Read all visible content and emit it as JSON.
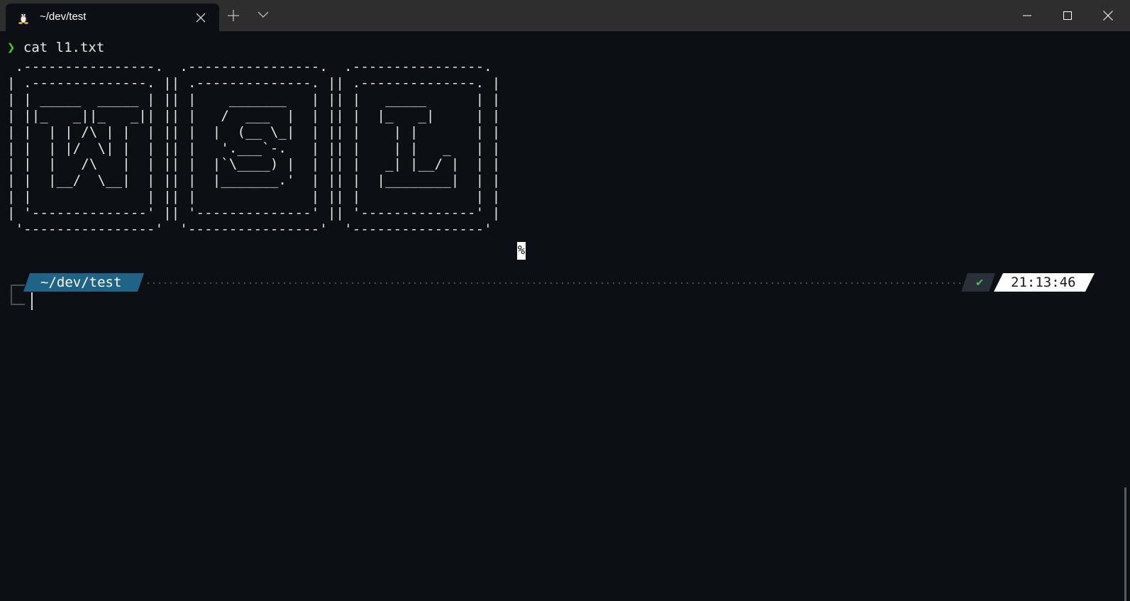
{
  "window": {
    "tab_title": "~/dev/test",
    "tab_icon": "linux-tux-icon"
  },
  "terminal": {
    "prompt_symbol": "❯",
    "command": "cat l1.txt",
    "ascii_art": " .----------------.  .----------------.  .----------------.\n| .--------------. || .--------------. || .--------------. |\n| | _____  _____ | || |    _______   | || |   _____      | |\n| ||_   _||_   _|| || |   /  ___  |  | || |  |_   _|     | |\n| |  | | /\\ | |  | || |  |  (__ \\_|  | || |    | |       | |\n| |  | |/  \\| |  | || |   '.___`-.   | || |    | |   _   | |\n| |  |   /\\   |  | || |  |`\\____) |  | || |   _| |__/ |  | |\n| |  |__/  \\__|  | || |  |_______.'  | || |  |________|  | |\n| |              | || |              | || |              | |\n| '--------------' || '--------------' || '--------------' |\n '----------------'  '----------------'  '----------------'",
    "no_newline_marker": "%"
  },
  "prompt": {
    "path": "~/dev/test",
    "status_icon": "✔",
    "time": "21:13:46"
  },
  "colors": {
    "background": "#0c1014",
    "titlebar": "#2e2e2e",
    "path_segment": "#1f6386",
    "prompt_chevron": "#4ec726",
    "status_check": "#3fbf52"
  }
}
